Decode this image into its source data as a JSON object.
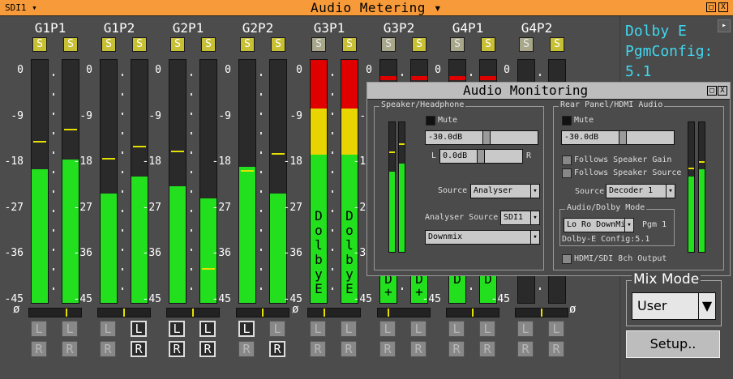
{
  "window": {
    "source_label": "SDI1",
    "title": "Audio Metering",
    "dropdown_glyph": "▾",
    "btn_restore": "□",
    "btn_close": "X"
  },
  "pairs": [
    "G1P1",
    "G1P2",
    "G2P1",
    "G2P2",
    "G3P1",
    "G3P2",
    "G4P1",
    "G4P2"
  ],
  "solo_label": "S",
  "scale_labels": [
    "0",
    "-9",
    "-18",
    "-27",
    "-36",
    "-45"
  ],
  "phase_glyph": "ø",
  "meter_texts": {
    "dolby": [
      "D",
      "o",
      "l",
      "b",
      "y",
      "E"
    ],
    "dplus": [
      "D",
      "+"
    ],
    "d": [
      "D"
    ]
  },
  "lr": {
    "left": "L",
    "right": "R"
  },
  "info": {
    "line1": "Dolby E",
    "line2": "PgmConfig:",
    "line3": "5.1",
    "arrow": "▸"
  },
  "monitoring": {
    "title": "Audio Monitoring",
    "speaker": {
      "group_label": "Speaker/Headphone",
      "mute_label": "Mute",
      "level_value": "-30.0dB",
      "balance_left": "L",
      "balance_value": "0.0dB",
      "balance_right": "R",
      "source_label": "Source",
      "source_value": "Analyser",
      "analyser_source_label": "Analyser Source",
      "analyser_source_value": "SDI1",
      "mix_value": "Downmix"
    },
    "rear": {
      "group_label": "Rear Panel/HDMI Audio",
      "mute_label": "Mute",
      "level_value": "-30.0dB",
      "follows_gain_label": "Follows Speaker Gain",
      "follows_source_label": "Follows Speaker Source",
      "source_label": "Source",
      "source_value": "Decoder 1",
      "dolby_group_label": "Audio/Dolby Mode",
      "dolby_mode_value": "Lo Ro DownMix",
      "pgm_label": "Pgm 1",
      "dolby_config": "Dolby-E Config:5.1",
      "hdmi_label": "HDMI/SDI 8ch Output"
    }
  },
  "mix_mode": {
    "label": "Mix Mode",
    "value": "User"
  },
  "setup_label": "Setup..",
  "colors": {
    "accent_orange": "#f79b3a",
    "meter_green": "#22e01e",
    "meter_yellow": "#e8d400",
    "meter_red": "#e00000",
    "info_cyan": "#3fd7f0",
    "solo_yellow": "#c8c034"
  }
}
